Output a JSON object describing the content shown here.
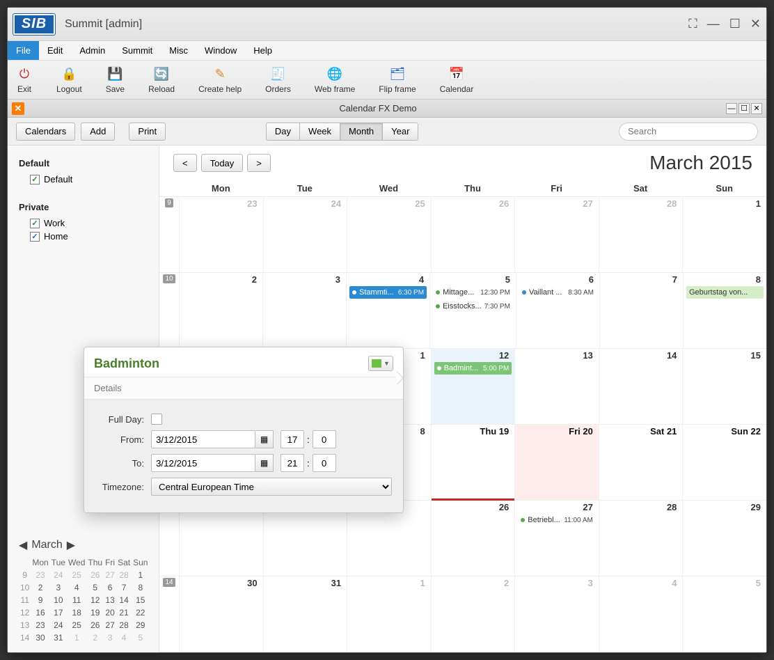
{
  "window": {
    "title": "Summit [admin]"
  },
  "menus": [
    "File",
    "Edit",
    "Admin",
    "Summit",
    "Misc",
    "Window",
    "Help"
  ],
  "active_menu": 0,
  "toolbar": [
    {
      "label": "Exit",
      "icon": "⏻",
      "color": "#c62828"
    },
    {
      "label": "Logout",
      "icon": "🔒",
      "color": "#888"
    },
    {
      "label": "Save",
      "icon": "💾",
      "color": "#555"
    },
    {
      "label": "Reload",
      "icon": "🔄",
      "color": "#2a6ad4"
    },
    {
      "label": "Create help",
      "icon": "✎",
      "color": "#d48a2a"
    },
    {
      "label": "Orders",
      "icon": "🧾",
      "color": "#888"
    },
    {
      "label": "Web frame",
      "icon": "🌐",
      "color": "#2a8a2a"
    },
    {
      "label": "Flip frame",
      "icon": "🗂",
      "color": "#2a6ad4"
    },
    {
      "label": "Calendar",
      "icon": "📅",
      "color": "#2a6ad4"
    }
  ],
  "subheader": {
    "title": "Calendar FX Demo"
  },
  "optbar": {
    "left": [
      "Calendars",
      "Add"
    ],
    "print": "Print",
    "views": [
      "Day",
      "Week",
      "Month",
      "Year"
    ],
    "active_view": 2,
    "search_ph": "Search"
  },
  "sidebar": {
    "groups": [
      {
        "title": "Default",
        "items": [
          {
            "label": "Default",
            "on": true,
            "cls": "on"
          }
        ]
      },
      {
        "title": "Private",
        "items": [
          {
            "label": "Work",
            "on": true,
            "cls": "on"
          },
          {
            "label": "Home",
            "on": true,
            "cls": "on blue"
          }
        ]
      }
    ],
    "mini": {
      "month_label": "March",
      "dow": [
        "Mon",
        "Tue",
        "Wed",
        "Thu",
        "Fri",
        "Sat",
        "Sun"
      ],
      "rows": [
        [
          {
            "n": "9",
            "wk": true
          },
          {
            "n": "23",
            "dim": true
          },
          {
            "n": "24",
            "dim": true
          },
          {
            "n": "25",
            "dim": true
          },
          {
            "n": "26",
            "dim": true
          },
          {
            "n": "27",
            "dim": true
          },
          {
            "n": "28",
            "dim": true
          },
          {
            "n": "1"
          }
        ],
        [
          {
            "n": "10",
            "wk": true
          },
          {
            "n": "2"
          },
          {
            "n": "3"
          },
          {
            "n": "4"
          },
          {
            "n": "5"
          },
          {
            "n": "6"
          },
          {
            "n": "7"
          },
          {
            "n": "8"
          }
        ],
        [
          {
            "n": "11",
            "wk": true
          },
          {
            "n": "9"
          },
          {
            "n": "10"
          },
          {
            "n": "11"
          },
          {
            "n": "12"
          },
          {
            "n": "13"
          },
          {
            "n": "14"
          },
          {
            "n": "15"
          }
        ],
        [
          {
            "n": "12",
            "wk": true
          },
          {
            "n": "16"
          },
          {
            "n": "17"
          },
          {
            "n": "18"
          },
          {
            "n": "19"
          },
          {
            "n": "20"
          },
          {
            "n": "21"
          },
          {
            "n": "22"
          }
        ],
        [
          {
            "n": "13",
            "wk": true
          },
          {
            "n": "23"
          },
          {
            "n": "24"
          },
          {
            "n": "25"
          },
          {
            "n": "26"
          },
          {
            "n": "27"
          },
          {
            "n": "28"
          },
          {
            "n": "29"
          }
        ],
        [
          {
            "n": "14",
            "wk": true
          },
          {
            "n": "30"
          },
          {
            "n": "31"
          },
          {
            "n": "1",
            "dim": true
          },
          {
            "n": "2",
            "dim": true
          },
          {
            "n": "3",
            "dim": true
          },
          {
            "n": "4",
            "dim": true
          },
          {
            "n": "5",
            "dim": true
          }
        ]
      ]
    }
  },
  "calendar": {
    "nav": {
      "prev": "<",
      "today": "Today",
      "next": ">"
    },
    "title": "March 2015",
    "dow": [
      "Mon",
      "Tue",
      "Wed",
      "Thu",
      "Fri",
      "Sat",
      "Sun"
    ],
    "weeks": [
      {
        "no": "9",
        "days": [
          {
            "n": "23",
            "dim": true
          },
          {
            "n": "24",
            "dim": true
          },
          {
            "n": "25",
            "dim": true
          },
          {
            "n": "26",
            "dim": true
          },
          {
            "n": "27",
            "dim": true
          },
          {
            "n": "28",
            "dim": true
          },
          {
            "n": "1"
          }
        ]
      },
      {
        "no": "10",
        "days": [
          {
            "n": "2"
          },
          {
            "n": "3"
          },
          {
            "n": "4",
            "ev": [
              {
                "cls": "blue",
                "dot": "w",
                "txt": "Stammti...",
                "time": "6:30 PM"
              }
            ]
          },
          {
            "n": "5",
            "ev": [
              {
                "cls": "plain",
                "dot": "g",
                "txt": "Mittage...",
                "time": "12:30 PM"
              },
              {
                "cls": "plain",
                "dot": "g",
                "txt": "Eisstocks...",
                "time": "7:30 PM"
              }
            ]
          },
          {
            "n": "6",
            "ev": [
              {
                "cls": "plain",
                "dot": "b",
                "txt": "Vaillant ...",
                "time": "8:30 AM"
              }
            ]
          },
          {
            "n": "7"
          },
          {
            "n": "8",
            "ev": [
              {
                "cls": "lightgreen",
                "txt": "Geburtstag von..."
              }
            ]
          }
        ]
      },
      {
        "no": "",
        "days": [
          {
            "n": "",
            "hidden": true
          },
          {
            "n": "",
            "hidden": true
          },
          {
            "n": "1",
            "hidden": true
          },
          {
            "n": "12",
            "today": true,
            "ev": [
              {
                "cls": "green",
                "dot": "w",
                "txt": "Badmint...",
                "time": "5:00 PM"
              }
            ]
          },
          {
            "n": "13"
          },
          {
            "n": "14"
          },
          {
            "n": "15"
          }
        ]
      },
      {
        "no": "",
        "days": [
          {
            "n": "",
            "hidden": true
          },
          {
            "n": "",
            "hidden": true
          },
          {
            "n": "8",
            "hidden": true
          },
          {
            "n": "Thu 19",
            "bold": true,
            "todaymark": true
          },
          {
            "n": "Fri 20",
            "red": true,
            "bold": true
          },
          {
            "n": "Sat 21",
            "bold": true
          },
          {
            "n": "Sun 22",
            "bold": true
          }
        ]
      },
      {
        "no": "",
        "days": [
          {
            "n": "",
            "hidden": true
          },
          {
            "n": "",
            "hidden": true
          },
          {
            "n": "",
            "hidden": true
          },
          {
            "n": "26"
          },
          {
            "n": "27",
            "ev": [
              {
                "cls": "plain",
                "dot": "g",
                "txt": "Betriebl...",
                "time": "11:00 AM"
              }
            ]
          },
          {
            "n": "28"
          },
          {
            "n": "29"
          }
        ]
      },
      {
        "no": "14",
        "days": [
          {
            "n": "30"
          },
          {
            "n": "31"
          },
          {
            "n": "1",
            "dim": true
          },
          {
            "n": "2",
            "dim": true
          },
          {
            "n": "3",
            "dim": true
          },
          {
            "n": "4",
            "dim": true
          },
          {
            "n": "5",
            "dim": true
          }
        ]
      }
    ]
  },
  "popup": {
    "title": "Badminton",
    "tab": "Details",
    "labels": {
      "fullday": "Full Day:",
      "from": "From:",
      "to": "To:",
      "tz": "Timezone:"
    },
    "from": {
      "date": "3/12/2015",
      "h": "17",
      "m": "0"
    },
    "to": {
      "date": "3/12/2015",
      "h": "21",
      "m": "0"
    },
    "tz": "Central European Time",
    "colon": ":"
  }
}
